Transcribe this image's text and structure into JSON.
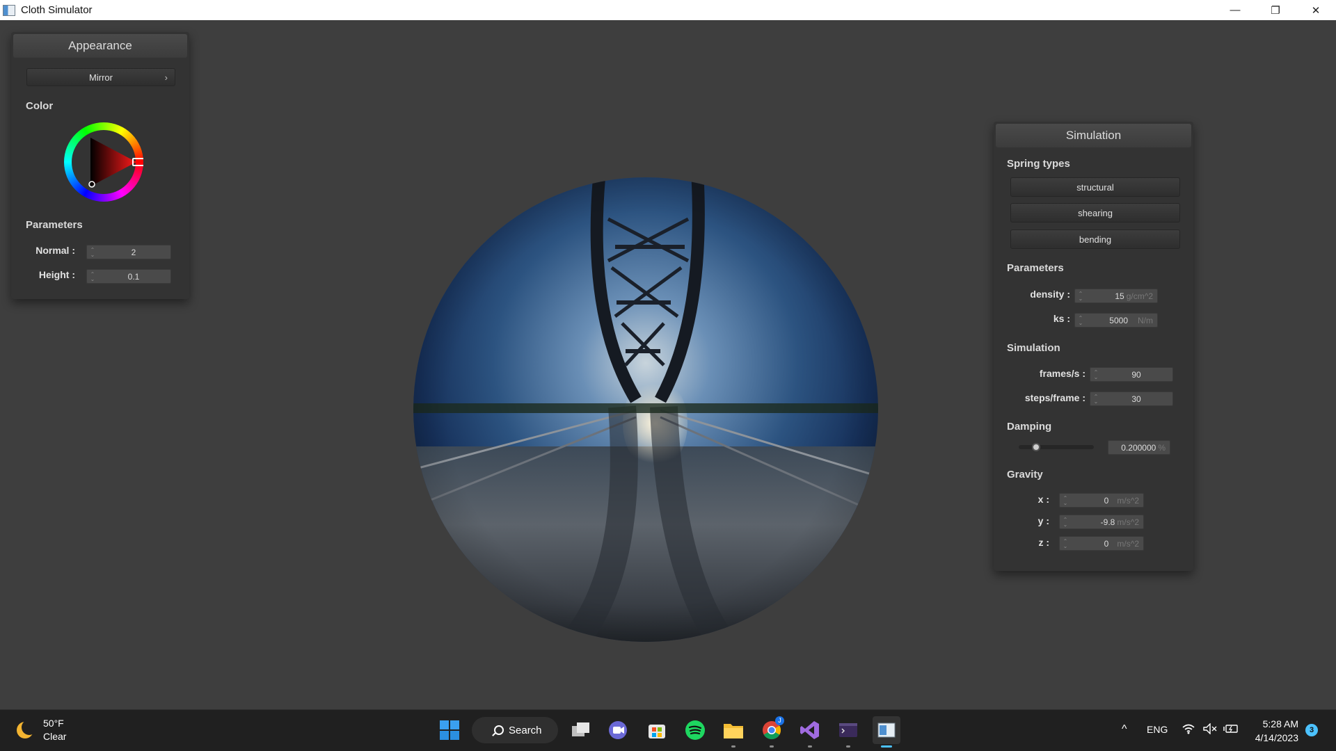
{
  "window": {
    "title": "Cloth Simulator",
    "minimize": "—",
    "restore": "❐",
    "close": "✕"
  },
  "appearance": {
    "title": "Appearance",
    "material": "Mirror",
    "material_arrow": "›",
    "color_label": "Color",
    "params_label": "Parameters",
    "normal_label": "Normal :",
    "normal_value": "2",
    "height_label": "Height :",
    "height_value": "0.1"
  },
  "simulation": {
    "title": "Simulation",
    "spring_types_label": "Spring types",
    "spring_types": [
      "structural",
      "shearing",
      "bending"
    ],
    "params_label": "Parameters",
    "density_label": "density :",
    "density_value": "15",
    "density_unit": "g/cm^2",
    "ks_label": "ks :",
    "ks_value": "5000",
    "ks_unit": "N/m",
    "sim_label": "Simulation",
    "fps_label": "frames/s :",
    "fps_value": "90",
    "steps_label": "steps/frame :",
    "steps_value": "30",
    "damping_label": "Damping",
    "damping_fraction": 0.2,
    "damping_value": "0.200000",
    "damping_unit": "%",
    "gravity_label": "Gravity",
    "gx_label": "x :",
    "gx_value": "0",
    "gy_label": "y :",
    "gy_value": "-9.8",
    "gz_label": "z :",
    "gz_value": "0",
    "g_unit": "m/s^2"
  },
  "taskbar": {
    "temp": "50°F",
    "condition": "Clear",
    "search": "Search",
    "lang": "ENG",
    "time": "5:28 AM",
    "date": "4/14/2023",
    "notif_count": "3",
    "chrome_badge": "J",
    "overflow_arrow": "^"
  },
  "colors": {
    "accent_red": "#e53935",
    "panel_bg": "#333333",
    "desktop_bg": "#3e3e3e"
  }
}
